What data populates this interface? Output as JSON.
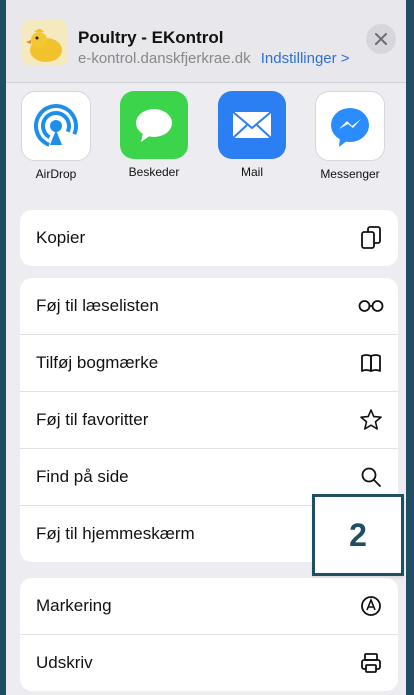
{
  "header": {
    "title": "Poultry - EKontrol",
    "subtitle": "e-kontrol.danskfjerkrae.dk",
    "settings_link": "Indstillinger >",
    "close_icon": "close-icon"
  },
  "apps": [
    {
      "label": "AirDrop",
      "icon": "airdrop-icon"
    },
    {
      "label": "Beskeder",
      "icon": "messages-icon"
    },
    {
      "label": "Mail",
      "icon": "mail-icon"
    },
    {
      "label": "Messenger",
      "icon": "messenger-icon"
    }
  ],
  "groups": [
    {
      "items": [
        {
          "label": "Kopier",
          "icon": "copy-icon"
        }
      ]
    },
    {
      "items": [
        {
          "label": "Føj til læselisten",
          "icon": "glasses-icon"
        },
        {
          "label": "Tilføj bogmærke",
          "icon": "book-icon"
        },
        {
          "label": "Føj til favoritter",
          "icon": "star-icon"
        },
        {
          "label": "Find på side",
          "icon": "search-icon"
        },
        {
          "label": "Føj til hjemmeskærm",
          "icon": "add-square-icon"
        }
      ]
    },
    {
      "items": [
        {
          "label": "Markering",
          "icon": "markup-icon"
        },
        {
          "label": "Udskriv",
          "icon": "print-icon"
        }
      ]
    }
  ],
  "callout": {
    "number": "2"
  },
  "colors": {
    "accent": "#2f6fe0",
    "callout": "#1f4f62",
    "sheet_bg": "#ececf1"
  }
}
